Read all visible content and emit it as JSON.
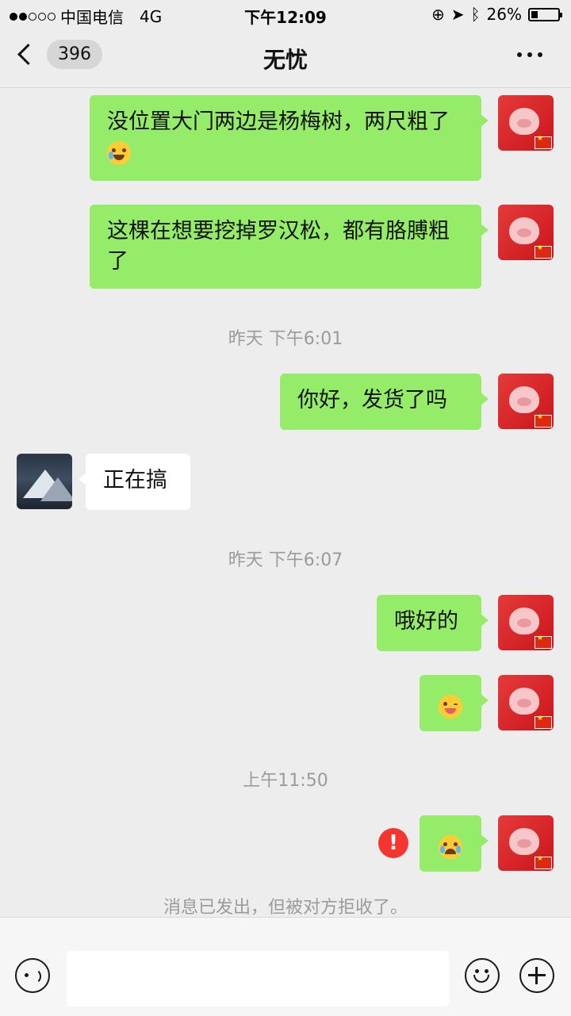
{
  "status_bar": {
    "carrier": "中国电信",
    "network": "4G",
    "time": "下午12:09",
    "battery": "26%",
    "battery_level": 0.26
  },
  "header": {
    "back_badge": "396",
    "title": "无忧"
  },
  "messages": [
    {
      "side": "right",
      "text": "没位置大门两边是杨梅树，两尺粗了",
      "emoji": "laughing-tears"
    },
    {
      "side": "right",
      "text": "这棵在想要挖掉罗汉松，都有胳膊粗了"
    },
    {
      "timestamp": "昨天 下午6:01"
    },
    {
      "side": "right",
      "text": "你好，发货了吗"
    },
    {
      "side": "left",
      "text": "正在搞"
    },
    {
      "timestamp": "昨天 下午6:07"
    },
    {
      "side": "right",
      "text": "哦好的"
    },
    {
      "side": "right",
      "emoji": "winking-tongue"
    },
    {
      "timestamp": "上午11:50"
    },
    {
      "side": "right",
      "emoji": "loudly-crying",
      "failed": true
    }
  ],
  "system_note": "消息已发出，但被对方拒收了。",
  "icons": {
    "voice": "voice-icon",
    "emoji": "emoji-icon",
    "add": "plus-icon",
    "failed": "exclamation-icon"
  },
  "colors": {
    "sent_bubble": "#95ec69",
    "received_bubble": "#ffffff",
    "error": "#f43530"
  }
}
